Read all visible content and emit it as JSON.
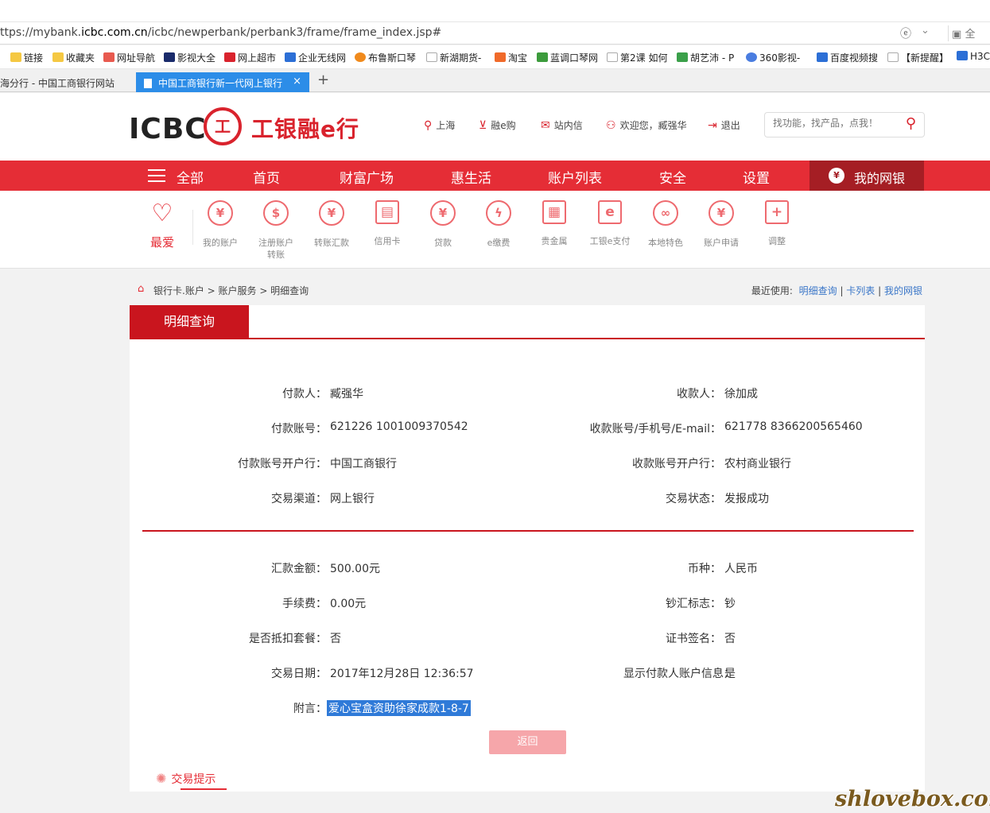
{
  "browser": {
    "url_prefix": "ttps://mybank.",
    "url_domain": "icbc.com.cn",
    "url_path": "/icbc/newperbank/perbank3/frame/frame_index.jsp#",
    "right_label": "全",
    "favorites": [
      "链接",
      "收藏夹",
      "网址导航",
      "影视大全",
      "网上超市",
      "企业无线网",
      "布鲁斯口琴",
      "新湖期货-",
      "淘宝",
      "蓝调口琴网",
      "第2课 如何",
      "胡艺沛 - P",
      "360影视-",
      "百度视频搜",
      "【新提醒】",
      "H3C"
    ],
    "tabs": [
      {
        "label": "海分行 - 中国工商银行网站"
      },
      {
        "label": "中国工商银行新一代网上银行"
      }
    ],
    "close_glyph": "×",
    "new_tab_glyph": "+"
  },
  "header": {
    "logo_en": "ICBC",
    "logo_seal": "工",
    "logo_cn": "工银融e行",
    "links": {
      "location": "上海",
      "shop": "融e购",
      "message": "站内信",
      "welcome": "欢迎您，臧强华",
      "logout": "退出"
    },
    "search_placeholder": "找功能，找产品，点我！"
  },
  "nav": {
    "all": "全部",
    "items": [
      "首页",
      "财富广场",
      "惠生活",
      "账户列表",
      "安全",
      "设置"
    ],
    "mybank": "我的网银"
  },
  "quick": {
    "favorite": "最爱",
    "items": [
      {
        "label": "我的账户",
        "glyph": "¥"
      },
      {
        "label": "注册账户转账",
        "glyph": "$"
      },
      {
        "label": "转账汇款",
        "glyph": "¥"
      },
      {
        "label": "信用卡",
        "glyph": "▤"
      },
      {
        "label": "贷款",
        "glyph": "¥"
      },
      {
        "label": "e缴费",
        "glyph": "ϟ"
      },
      {
        "label": "贵金属",
        "glyph": "▦"
      },
      {
        "label": "工银e支付",
        "glyph": "e"
      },
      {
        "label": "本地特色",
        "glyph": "∞"
      },
      {
        "label": "账户申请",
        "glyph": "¥"
      },
      {
        "label": "调整",
        "glyph": "+"
      }
    ]
  },
  "breadcrumb": {
    "path": "银行卡.账户 > 账户服务 > 明细查询",
    "recent_label": "最近使用:",
    "recent_links": [
      "明细查询",
      "卡列表",
      "我的网银"
    ]
  },
  "detail": {
    "tab_title": "明细查询",
    "payer_label": "付款人：",
    "payer": "臧强华",
    "payee_label": "收款人：",
    "payee": "徐加成",
    "payer_account_label": "付款账号：",
    "payer_account": "621226 1001009370542",
    "payee_account_label": "收款账号/手机号/E-mail：",
    "payee_account": "621778 8366200565460",
    "payer_bank_label": "付款账号开户行：",
    "payer_bank": "中国工商银行",
    "payee_bank_label": "收款账号开户行：",
    "payee_bank": "农村商业银行",
    "channel_label": "交易渠道：",
    "channel": "网上银行",
    "status_label": "交易状态：",
    "status": "发报成功",
    "amount_label": "汇款金额：",
    "amount": "500.00元",
    "currency_label": "币种：",
    "currency": "人民币",
    "fee_label": "手续费：",
    "fee": "0.00元",
    "cash_flag_label": "钞汇标志：",
    "cash_flag": "钞",
    "package_label": "是否抵扣套餐：",
    "package": "否",
    "cert_sign_label": "证书签名：",
    "cert_sign": "否",
    "date_label": "交易日期：",
    "date": "2017年12月28日 12:36:57",
    "show_payer_label": "显示付款人账户信息：",
    "show_payer": "是",
    "memo_label": "附言：",
    "memo": "爱心宝盒资助徐家成款1-8-7",
    "back_button": "返回"
  },
  "tips": {
    "label": "交易提示"
  },
  "watermark": "shlovebox.com",
  "colors": {
    "brand_red": "#e52d36",
    "dark_red": "#c9151e",
    "link_blue": "#3a76c8"
  }
}
